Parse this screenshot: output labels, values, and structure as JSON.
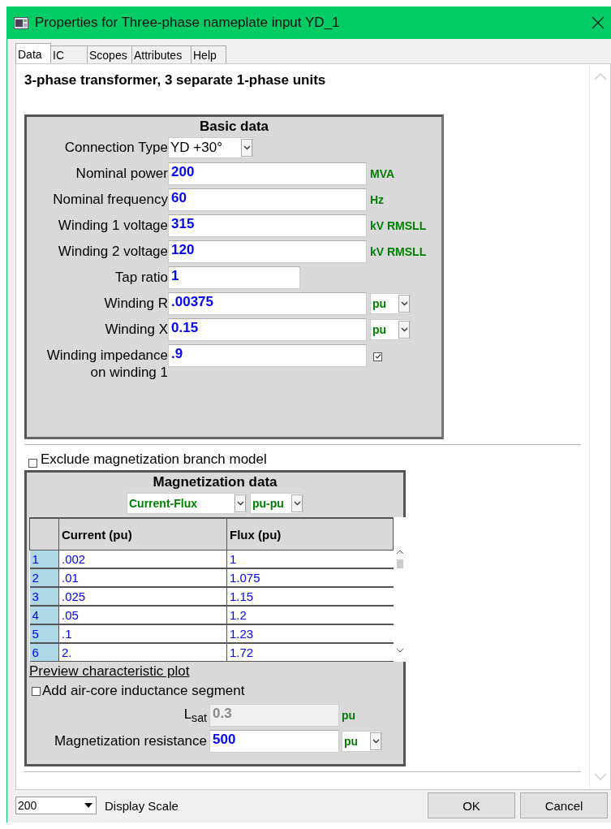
{
  "window": {
    "title": "Properties for Three-phase nameplate input YD_1"
  },
  "tabs": [
    {
      "label": "Data",
      "selected": true
    },
    {
      "label": "IC",
      "selected": false
    },
    {
      "label": "Scopes",
      "selected": false
    },
    {
      "label": "Attributes",
      "selected": false
    },
    {
      "label": "Help",
      "selected": false
    }
  ],
  "heading": "3-phase transformer, 3 separate 1-phase units",
  "basic_data": {
    "title": "Basic data",
    "fields": [
      {
        "kind": "select",
        "label": "Connection Type",
        "value": "YD +30°"
      },
      {
        "kind": "input",
        "label": "Nominal power",
        "value": "200",
        "unit": "MVA"
      },
      {
        "kind": "input",
        "label": "Nominal frequency",
        "value": "60",
        "unit": "Hz"
      },
      {
        "kind": "input",
        "label": "Winding 1 voltage",
        "value": "315",
        "unit": "kV RMSLL"
      },
      {
        "kind": "input",
        "label": "Winding 2 voltage",
        "value": "120",
        "unit": "kV RMSLL"
      },
      {
        "kind": "short",
        "label": "Tap ratio",
        "value": "1"
      },
      {
        "kind": "unitselect",
        "label": "Winding R",
        "value": ".00375",
        "unit": "pu"
      },
      {
        "kind": "unitselect",
        "label": "Winding X",
        "value": "0.15",
        "unit": "pu"
      },
      {
        "kind": "check",
        "label": "Winding impedance\non winding 1",
        "value": ".9",
        "checked": true
      }
    ]
  },
  "exclude_magnetization": {
    "label": "Exclude magnetization branch model",
    "checked": false
  },
  "magnetization": {
    "title": "Magnetization data",
    "curve_type": "Current-Flux",
    "units": "pu-pu",
    "columns": [
      "Current (pu)",
      "Flux (pu)"
    ],
    "rows": [
      {
        "index": "1",
        "current": ".002",
        "flux": "1"
      },
      {
        "index": "2",
        "current": ".01",
        "flux": "1.075"
      },
      {
        "index": "3",
        "current": ".025",
        "flux": "1.15"
      },
      {
        "index": "4",
        "current": ".05",
        "flux": "1.2"
      },
      {
        "index": "5",
        "current": ".1",
        "flux": "1.23"
      },
      {
        "index": "6",
        "current": "2.",
        "flux": "1.72"
      }
    ],
    "preview_link": "Preview characteristic plot",
    "air_core": {
      "label": "Add air-core inductance segment",
      "checked": false
    },
    "lsat": {
      "label": "L$_{sat}$",
      "value": "0.3",
      "unit": "pu",
      "disabled": true
    },
    "resistance": {
      "label": "Magnetization resistance",
      "value": "500",
      "unit": "pu"
    }
  },
  "footer": {
    "display_scale": {
      "value": "200",
      "label": "Display Scale"
    },
    "buttons": [
      "OK",
      "Cancel"
    ]
  }
}
